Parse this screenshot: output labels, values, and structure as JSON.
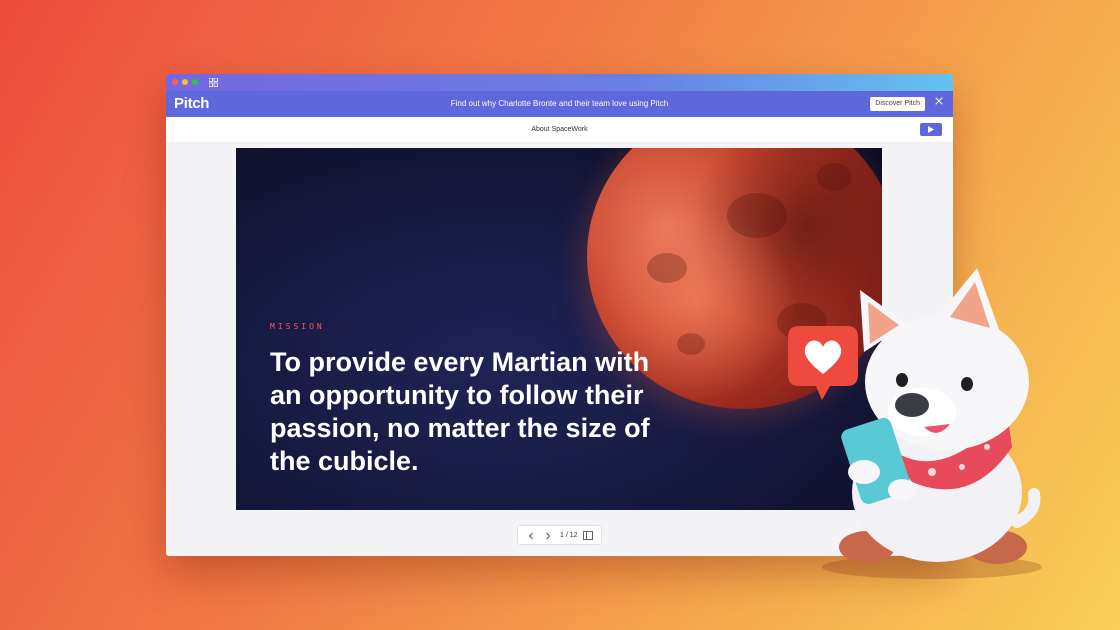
{
  "banner": {
    "logo": "Pitch",
    "message": "Find out why Charlotte Bronte and their team love using Pitch",
    "cta_label": "Discover Pitch"
  },
  "deck": {
    "title": "About SpaceWork"
  },
  "slide": {
    "label": "MISSION",
    "body": "To provide every Martian with an opportunity to follow their passion, no matter the size of the cubicle."
  },
  "pager": {
    "count": "1 / 12"
  },
  "colors": {
    "accent": "#5f67dd",
    "mission_label": "#ff5a4f",
    "slide_bg": "#15183d"
  },
  "icons": [
    "grid-icon",
    "close-icon",
    "play-icon",
    "chevron-left-icon",
    "chevron-right-icon",
    "panel-icon"
  ]
}
